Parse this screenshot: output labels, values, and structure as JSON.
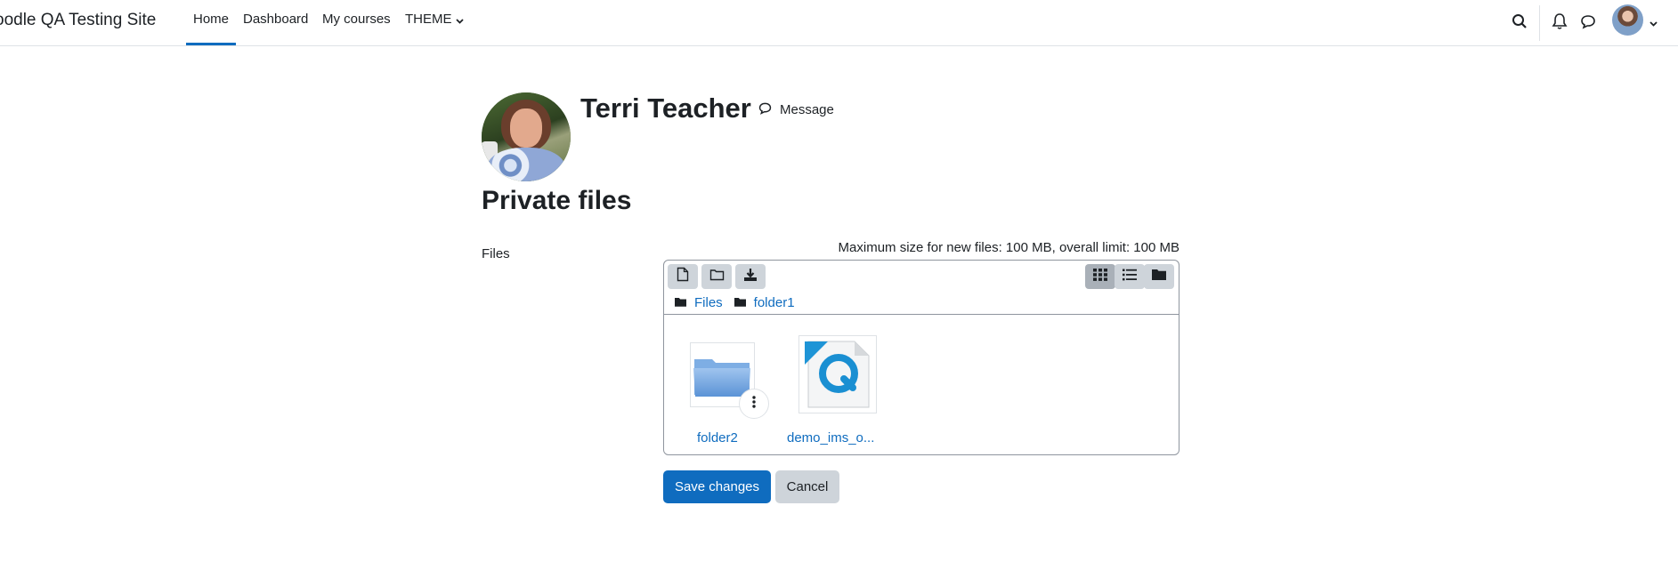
{
  "navbar": {
    "brand": "oodle QA Testing Site",
    "items": [
      {
        "label": "Home",
        "active": true
      },
      {
        "label": "Dashboard"
      },
      {
        "label": "My courses"
      },
      {
        "label": "THEME"
      }
    ],
    "icons": [
      "search-icon",
      "bell-icon",
      "chat-icon",
      "avatar",
      "chevron-down-icon"
    ]
  },
  "profile": {
    "name": "Terri Teacher",
    "message_label": "Message"
  },
  "page": {
    "title": "Private files"
  },
  "form": {
    "files_label": "Files",
    "limits_text": "Maximum size for new files: 100 MB, overall limit: 100 MB",
    "breadcrumb": [
      "Files",
      "folder1"
    ],
    "files": [
      {
        "name": "folder2",
        "type": "folder"
      },
      {
        "name": "demo_ims_o...",
        "type": "quicktime"
      }
    ],
    "save_label": "Save changes",
    "cancel_label": "Cancel"
  },
  "colors": {
    "primary": "#0f6cbf",
    "text": "#1d2125",
    "border": "#dee2e6",
    "button_secondary": "#ced4da"
  }
}
